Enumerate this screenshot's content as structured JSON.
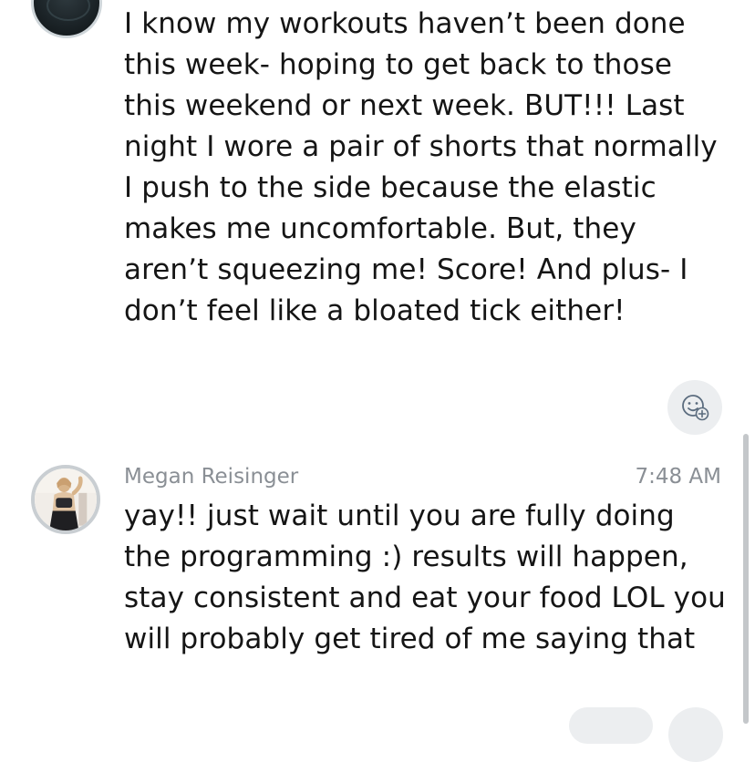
{
  "messages": [
    {
      "text": "I know my workouts haven’t been done this week- hoping to get back to those this weekend or next week. BUT!!! Last night I wore a pair of shorts that normally I push to the side because the elastic makes me uncomfortable. But, they aren’t squeezing me! Score! And plus- I don’t feel like a bloated tick either!",
      "reaction_icon": "add-reaction-icon"
    },
    {
      "sender": "Megan Reisinger",
      "time": "7:48 AM",
      "text": "yay!! just wait until you are fully doing the programming :) results will happen, stay consistent and eat your food LOL you will probably get tired of me saying that"
    }
  ]
}
